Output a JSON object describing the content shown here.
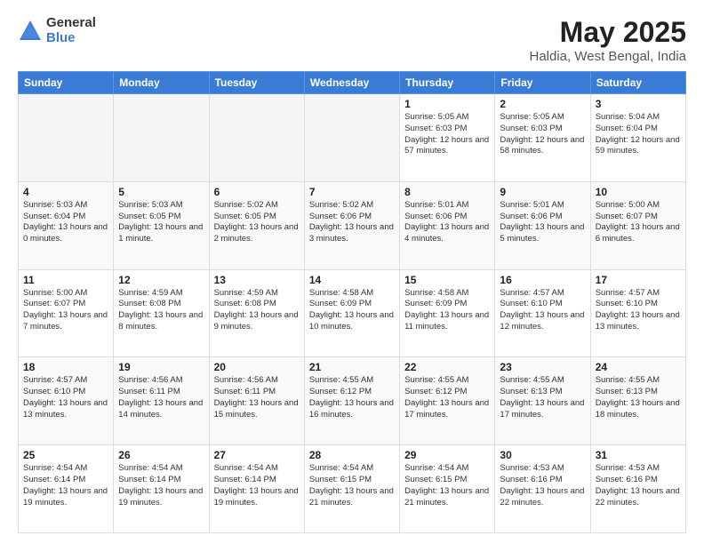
{
  "logo": {
    "general": "General",
    "blue": "Blue"
  },
  "header": {
    "title": "May 2025",
    "subtitle": "Haldia, West Bengal, India"
  },
  "weekdays": [
    "Sunday",
    "Monday",
    "Tuesday",
    "Wednesday",
    "Thursday",
    "Friday",
    "Saturday"
  ],
  "weeks": [
    [
      {
        "day": "",
        "empty": true
      },
      {
        "day": "",
        "empty": true
      },
      {
        "day": "",
        "empty": true
      },
      {
        "day": "",
        "empty": true
      },
      {
        "day": "1",
        "sunrise": "5:05 AM",
        "sunset": "6:03 PM",
        "daylight": "12 hours and 57 minutes."
      },
      {
        "day": "2",
        "sunrise": "5:05 AM",
        "sunset": "6:03 PM",
        "daylight": "12 hours and 58 minutes."
      },
      {
        "day": "3",
        "sunrise": "5:04 AM",
        "sunset": "6:04 PM",
        "daylight": "12 hours and 59 minutes."
      }
    ],
    [
      {
        "day": "4",
        "sunrise": "5:03 AM",
        "sunset": "6:04 PM",
        "daylight": "13 hours and 0 minutes."
      },
      {
        "day": "5",
        "sunrise": "5:03 AM",
        "sunset": "6:05 PM",
        "daylight": "13 hours and 1 minute."
      },
      {
        "day": "6",
        "sunrise": "5:02 AM",
        "sunset": "6:05 PM",
        "daylight": "13 hours and 2 minutes."
      },
      {
        "day": "7",
        "sunrise": "5:02 AM",
        "sunset": "6:06 PM",
        "daylight": "13 hours and 3 minutes."
      },
      {
        "day": "8",
        "sunrise": "5:01 AM",
        "sunset": "6:06 PM",
        "daylight": "13 hours and 4 minutes."
      },
      {
        "day": "9",
        "sunrise": "5:01 AM",
        "sunset": "6:06 PM",
        "daylight": "13 hours and 5 minutes."
      },
      {
        "day": "10",
        "sunrise": "5:00 AM",
        "sunset": "6:07 PM",
        "daylight": "13 hours and 6 minutes."
      }
    ],
    [
      {
        "day": "11",
        "sunrise": "5:00 AM",
        "sunset": "6:07 PM",
        "daylight": "13 hours and 7 minutes."
      },
      {
        "day": "12",
        "sunrise": "4:59 AM",
        "sunset": "6:08 PM",
        "daylight": "13 hours and 8 minutes."
      },
      {
        "day": "13",
        "sunrise": "4:59 AM",
        "sunset": "6:08 PM",
        "daylight": "13 hours and 9 minutes."
      },
      {
        "day": "14",
        "sunrise": "4:58 AM",
        "sunset": "6:09 PM",
        "daylight": "13 hours and 10 minutes."
      },
      {
        "day": "15",
        "sunrise": "4:58 AM",
        "sunset": "6:09 PM",
        "daylight": "13 hours and 11 minutes."
      },
      {
        "day": "16",
        "sunrise": "4:57 AM",
        "sunset": "6:10 PM",
        "daylight": "13 hours and 12 minutes."
      },
      {
        "day": "17",
        "sunrise": "4:57 AM",
        "sunset": "6:10 PM",
        "daylight": "13 hours and 13 minutes."
      }
    ],
    [
      {
        "day": "18",
        "sunrise": "4:57 AM",
        "sunset": "6:10 PM",
        "daylight": "13 hours and 13 minutes."
      },
      {
        "day": "19",
        "sunrise": "4:56 AM",
        "sunset": "6:11 PM",
        "daylight": "13 hours and 14 minutes."
      },
      {
        "day": "20",
        "sunrise": "4:56 AM",
        "sunset": "6:11 PM",
        "daylight": "13 hours and 15 minutes."
      },
      {
        "day": "21",
        "sunrise": "4:55 AM",
        "sunset": "6:12 PM",
        "daylight": "13 hours and 16 minutes."
      },
      {
        "day": "22",
        "sunrise": "4:55 AM",
        "sunset": "6:12 PM",
        "daylight": "13 hours and 17 minutes."
      },
      {
        "day": "23",
        "sunrise": "4:55 AM",
        "sunset": "6:13 PM",
        "daylight": "13 hours and 17 minutes."
      },
      {
        "day": "24",
        "sunrise": "4:55 AM",
        "sunset": "6:13 PM",
        "daylight": "13 hours and 18 minutes."
      }
    ],
    [
      {
        "day": "25",
        "sunrise": "4:54 AM",
        "sunset": "6:14 PM",
        "daylight": "13 hours and 19 minutes."
      },
      {
        "day": "26",
        "sunrise": "4:54 AM",
        "sunset": "6:14 PM",
        "daylight": "13 hours and 19 minutes."
      },
      {
        "day": "27",
        "sunrise": "4:54 AM",
        "sunset": "6:14 PM",
        "daylight": "13 hours and 19 minutes."
      },
      {
        "day": "28",
        "sunrise": "4:54 AM",
        "sunset": "6:15 PM",
        "daylight": "13 hours and 21 minutes."
      },
      {
        "day": "29",
        "sunrise": "4:54 AM",
        "sunset": "6:15 PM",
        "daylight": "13 hours and 21 minutes."
      },
      {
        "day": "30",
        "sunrise": "4:53 AM",
        "sunset": "6:16 PM",
        "daylight": "13 hours and 22 minutes."
      },
      {
        "day": "31",
        "sunrise": "4:53 AM",
        "sunset": "6:16 PM",
        "daylight": "13 hours and 22 minutes."
      }
    ]
  ]
}
